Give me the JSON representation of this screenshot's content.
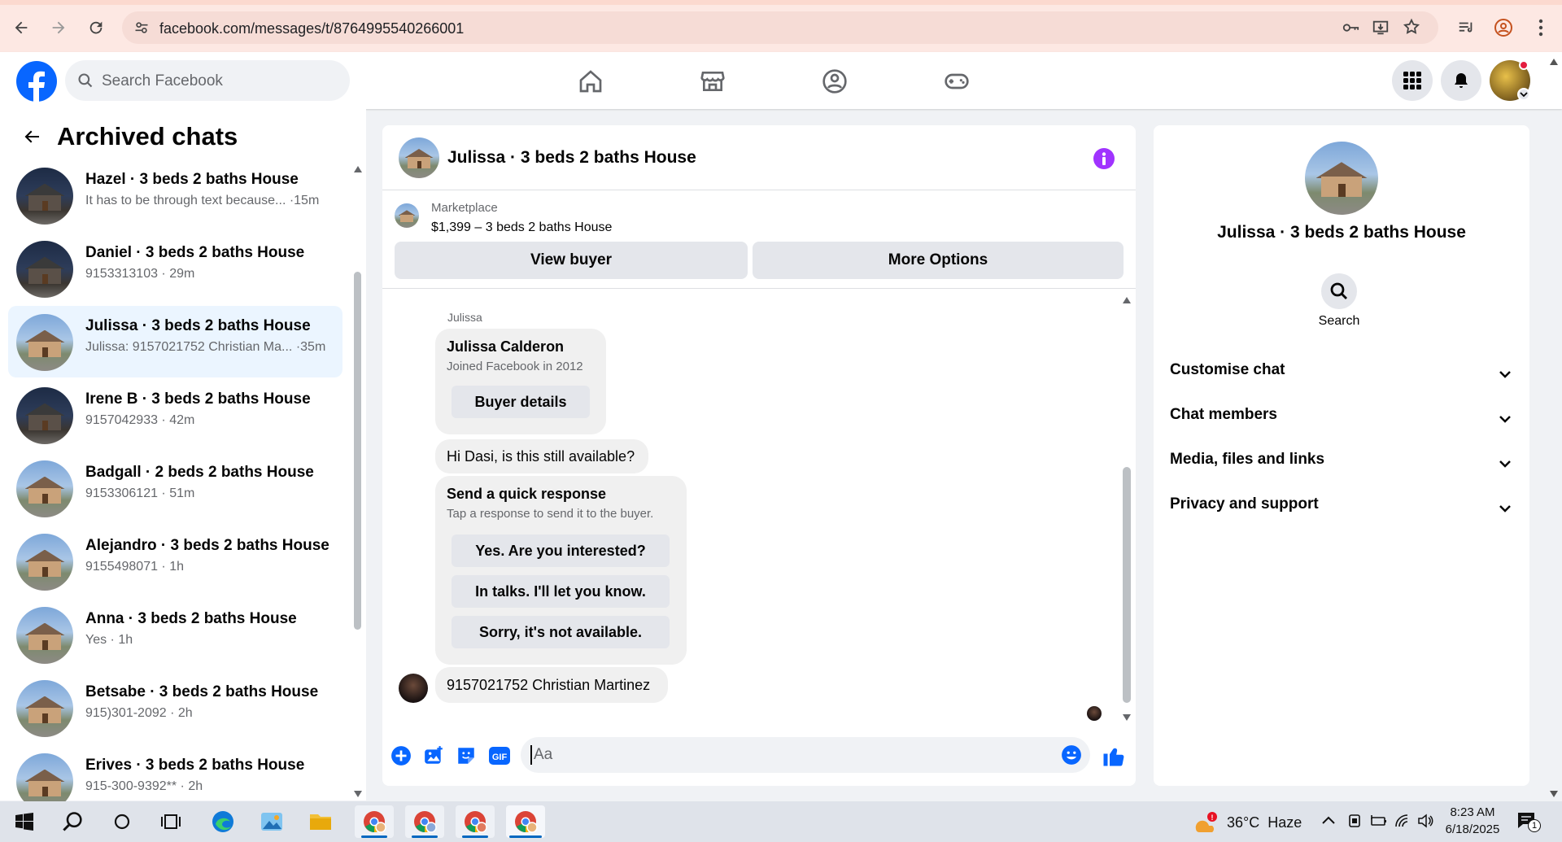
{
  "browser": {
    "url": "facebook.com/messages/t/8764995540266001"
  },
  "header": {
    "search_placeholder": "Search Facebook"
  },
  "archived": {
    "title": "Archived chats",
    "chats": [
      {
        "name": "Hazel · 3 beds 2 baths House",
        "preview": "It has to be through text because... ·15m",
        "avatar": "dark"
      },
      {
        "name": "Daniel · 3 beds 2 baths House",
        "preview": "9153313103 · 29m",
        "avatar": "dark"
      },
      {
        "name": "Julissa · 3 beds 2 baths House",
        "preview": "Julissa: 9157021752 Christian Ma... ·35m",
        "avatar": "light",
        "active": true
      },
      {
        "name": "Irene B · 3 beds 2 baths House",
        "preview": "9157042933 · 42m",
        "avatar": "dark"
      },
      {
        "name": "Badgall · 2 beds 2 baths House",
        "preview": "9153306121 · 51m",
        "avatar": "light"
      },
      {
        "name": "Alejandro · 3 beds 2 baths House",
        "preview": "9155498071 · 1h",
        "avatar": "light"
      },
      {
        "name": "Anna · 3 beds 2 baths House",
        "preview": "Yes · 1h",
        "avatar": "light"
      },
      {
        "name": "Betsabe · 3 beds 2 baths House",
        "preview": "915)301-2092 · 2h",
        "avatar": "light"
      },
      {
        "name": "Erives · 3 beds 2 baths House",
        "preview": "915-300-9392** · 2h",
        "avatar": "light"
      }
    ]
  },
  "conversation": {
    "title": "Julissa · 3 beds 2 baths House",
    "marketplace_label": "Marketplace",
    "listing": "$1,399 – 3 beds 2 baths House",
    "view_buyer": "View buyer",
    "more_options": "More Options",
    "sender_label": "Julissa",
    "profile_card": {
      "name": "Julissa Calderon",
      "joined": "Joined Facebook in 2012",
      "button": "Buyer details"
    },
    "message1": "Hi Dasi, is this still available?",
    "quick": {
      "title": "Send a quick response",
      "subtitle": "Tap a response to send it to the buyer.",
      "options": [
        "Yes. Are you interested?",
        "In talks. I'll let you know.",
        "Sorry, it's not available."
      ]
    },
    "message2": "9157021752 Christian Martinez",
    "composer_placeholder": "Aa"
  },
  "details": {
    "title": "Julissa · 3 beds 2 baths House",
    "search_label": "Search",
    "sections": [
      "Customise chat",
      "Chat members",
      "Media, files and links",
      "Privacy and support"
    ]
  },
  "taskbar": {
    "weather": "36°C  Haze",
    "time": "8:23 AM",
    "date": "6/18/2025",
    "notif_count": "1"
  },
  "colors": {
    "fb_blue": "#0866ff",
    "messenger_purple": "#a033ff"
  }
}
